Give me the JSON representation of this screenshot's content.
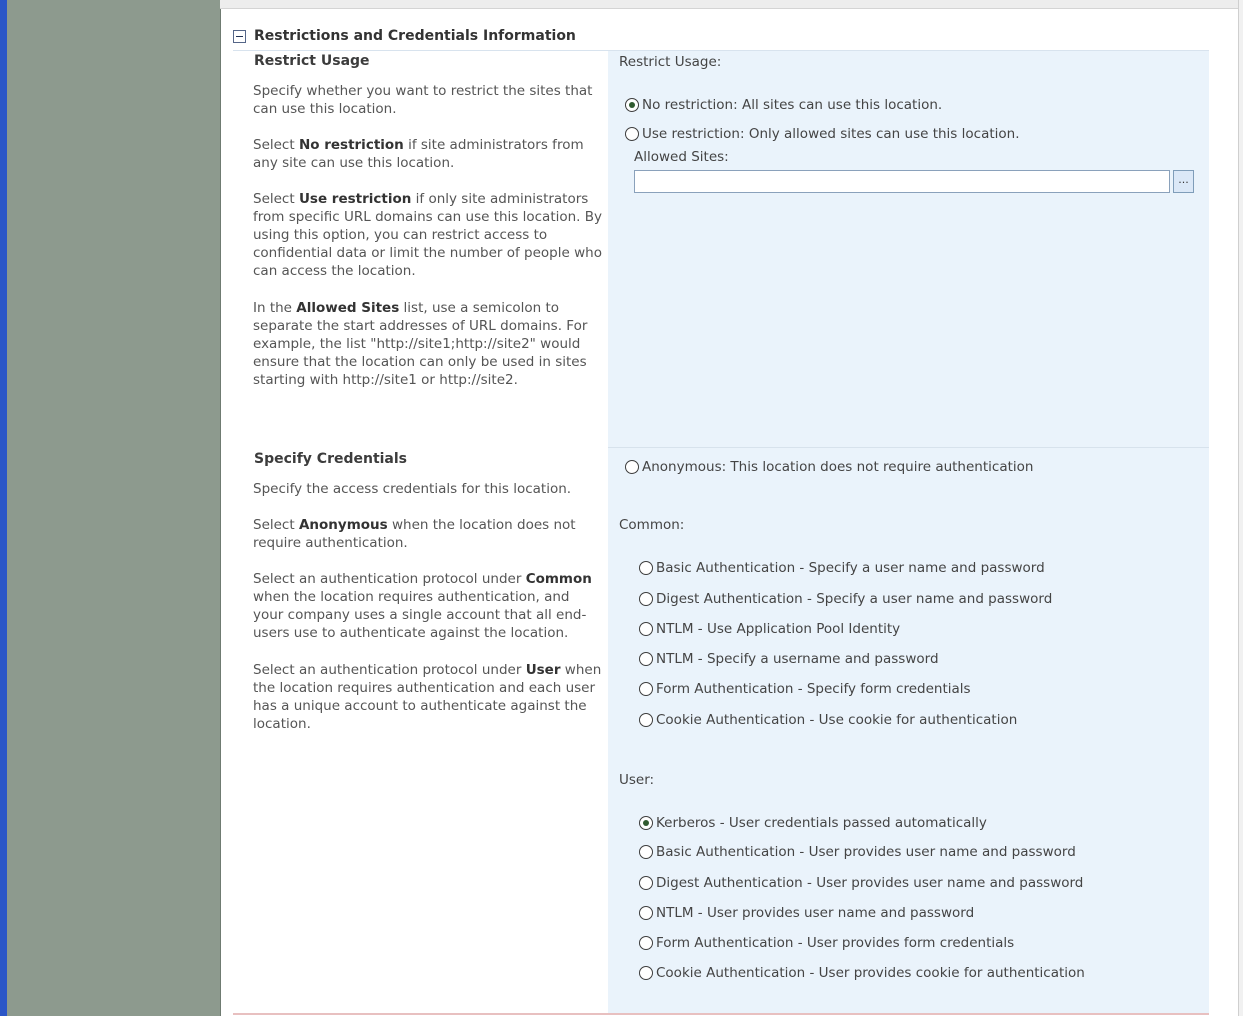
{
  "section": {
    "title": "Restrictions and Credentials Information"
  },
  "restrict": {
    "heading": "Restrict Usage",
    "para1": "Specify whether you want to restrict the sites that can use this location.",
    "para2": {
      "pre": "Select ",
      "bold": "No restriction",
      "post": " if site administrators from any site can use this location."
    },
    "para3": {
      "pre": "Select ",
      "bold": "Use restriction",
      "post": " if only site administrators from specific URL domains can use this location. By using this option, you can restrict access to confidential data or limit the number of people who can access the location."
    },
    "para4": {
      "pre": "In the ",
      "bold": "Allowed Sites",
      "post": " list, use a semicolon to separate the start addresses of URL domains. For example, the list \"http://site1;http://site2\" would ensure that the location can only be used in sites starting with http://site1 or http://site2."
    },
    "panel_label": "Restrict Usage:",
    "options": [
      {
        "label": "No restriction: All sites can use this location.",
        "checked": true
      },
      {
        "label": "Use restriction: Only allowed sites can use this location.",
        "checked": false
      }
    ],
    "allowed_sites_label": "Allowed Sites:",
    "allowed_sites_value": "",
    "browse_label": "..."
  },
  "credentials": {
    "heading": "Specify Credentials",
    "para1": "Specify the access credentials for this location.",
    "para2": {
      "pre": "Select ",
      "bold": "Anonymous",
      "post": " when the location does not require authentication."
    },
    "para3": {
      "pre": "Select an authentication protocol under ",
      "bold": "Common",
      "post": " when the location requires authentication, and your company uses a single account that all end-users use to authenticate against the location."
    },
    "para4": {
      "pre": "Select an authentication protocol under ",
      "bold": "User",
      "post": " when the location requires authentication and each user has a unique account to authenticate against the location."
    },
    "anonymous": {
      "label": "Anonymous: This location does not require authentication",
      "checked": false
    },
    "common_label": "Common:",
    "common_options": [
      {
        "label": "Basic Authentication - Specify a user name and password",
        "checked": false
      },
      {
        "label": "Digest Authentication - Specify a user name and password",
        "checked": false
      },
      {
        "label": "NTLM - Use Application Pool Identity",
        "checked": false
      },
      {
        "label": "NTLM - Specify a username and password",
        "checked": false
      },
      {
        "label": "Form Authentication - Specify form credentials",
        "checked": false
      },
      {
        "label": "Cookie Authentication - Use cookie for authentication",
        "checked": false
      }
    ],
    "user_label": "User:",
    "user_options": [
      {
        "label": "Kerberos - User credentials passed automatically",
        "checked": true
      },
      {
        "label": "Basic Authentication - User provides user name and password",
        "checked": false
      },
      {
        "label": "Digest Authentication - User provides user name and password",
        "checked": false
      },
      {
        "label": "NTLM - User provides user name and password",
        "checked": false
      },
      {
        "label": "Form Authentication - User provides form credentials",
        "checked": false
      },
      {
        "label": "Cookie Authentication - User provides cookie for authentication",
        "checked": false
      }
    ]
  }
}
